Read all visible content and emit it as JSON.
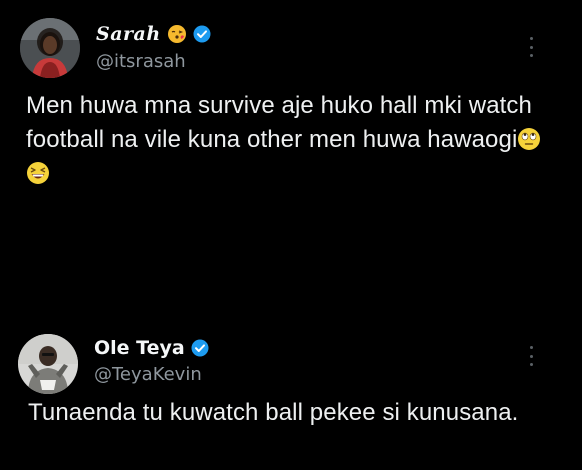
{
  "tweets": [
    {
      "display_name": "Sarah",
      "handle": "@itsrasah",
      "name_emoji": "face-blowing-kiss-emoji",
      "verified": true,
      "text": "Men huwa mna survive aje huko hall mki watch football na vile kuna other men huwa hawaogi",
      "trailing_emojis": [
        "face-with-rolling-eyes-emoji",
        "grinning-squinting-face-emoji"
      ]
    },
    {
      "display_name": "Ole Teya",
      "handle": "@TeyaKevin",
      "verified": true,
      "text": "Tunaenda tu kuwatch ball pekee si kunusana."
    }
  ],
  "colors": {
    "background": "#000000",
    "text": "#eef0f1",
    "secondary_text": "#8f979e",
    "verified_blue": "#1d9bf0"
  }
}
